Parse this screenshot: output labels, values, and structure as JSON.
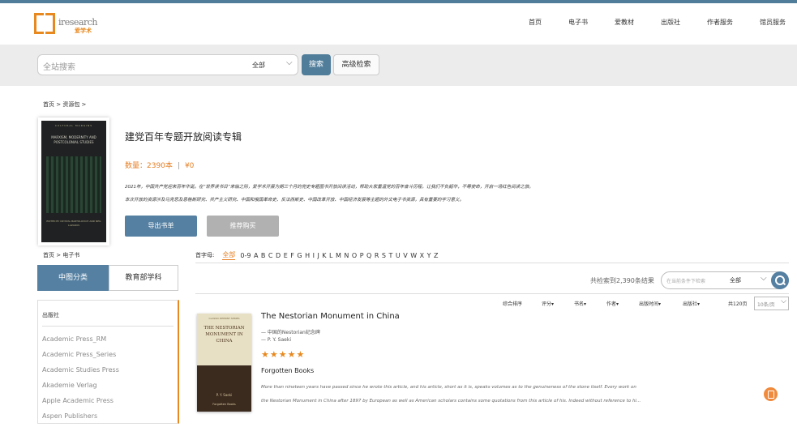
{
  "header": {
    "logo_text": "iresearch",
    "logo_sub": "爱学术",
    "nav": [
      "首页",
      "电子书",
      "爱教材",
      "出版社",
      "作者服务",
      "馆员服务"
    ]
  },
  "search": {
    "placeholder": "全站搜索",
    "scope": "全部",
    "search_button": "搜索",
    "advanced_button": "高级检索"
  },
  "breadcrumb_top": "首页 > 资源包 >",
  "collection": {
    "title": "建党百年专题开放阅读专辑",
    "count": "数量：2390本",
    "price": "¥0",
    "desc_line1": "2021年，中国共产党迎来百年华诞。在“世界读书日”来临之际，爱学术开展为期三个月的党史专题图书开放阅读活动，帮助大家重温党的百年奋斗历程，让我们不负韶华，不辱使命，开启一场红色阅读之旅。",
    "desc_line2": "本次开放的资源涉及马克思及恩格斯研究、共产主义研究、中国和俄国革命史、反法西斯史、中国改革开放、中国经济发展等主题的外文电子书资源，具有重要的学习意义。",
    "export_button": "导出书单",
    "recommend_button": "推荐购买",
    "cover": {
      "series": "CULTURAL MARGINS",
      "title": "MARXISM, MODERNITY AND POSTCOLONIAL STUDIES",
      "editors": "EDITED BY CRYSTAL BARTOLOVICH AND NEIL LAZARUS"
    }
  },
  "breadcrumb_left": "首页 > 电子书",
  "sidebar": {
    "tab_cn": "中图分类",
    "tab_edu": "教育部学科",
    "publisher_heading": "出版社",
    "publishers": [
      "Academic Press_RM",
      "Academic Press_Series",
      "Academic Studies Press",
      "Akademie Verlag",
      "Apple Academic Press",
      "Aspen Publishers"
    ]
  },
  "alphabet": {
    "label": "首字母:",
    "all": "全部",
    "letters": [
      "0-9",
      "A",
      "B",
      "C",
      "D",
      "E",
      "F",
      "G",
      "H",
      "I",
      "J",
      "K",
      "L",
      "M",
      "N",
      "O",
      "P",
      "Q",
      "R",
      "S",
      "T",
      "U",
      "V",
      "W",
      "X",
      "Y",
      "Z"
    ]
  },
  "results": {
    "count_text": "共检索到2,390条结果",
    "filter_placeholder": "在当前条件下检索",
    "filter_scope": "全部",
    "sort": [
      "综合排序",
      "评分",
      "书名",
      "作者",
      "出版时间",
      "出版社"
    ],
    "pages_text": "共120页",
    "per_page": "10条/页"
  },
  "book": {
    "title": "The Nestorian Monument in China",
    "subtitle": "— 中国的Nestorian纪念碑",
    "author": "— P. Y. Saeki",
    "stars": "★★★★★",
    "publisher": "Forgotten Books",
    "desc1": "More than nineteen years have passed since he wrote this article, and his article, short as it is, speaks volumes as to the genuineness of the stone itself. Every work on",
    "desc2": "the Nestorian Monument in China after 1897 by European as well as American scholars contains some quotations from this article of his. Indeed without reference to hi...",
    "cover_series": "CLASSIC REPRINT SERIES",
    "cover_title": "THE NESTORIAN MONUMENT IN CHINA",
    "cover_author": "P. Y. Saeki",
    "cover_pub": "Forgotten Books"
  },
  "colors": {
    "primary": "#5580a2",
    "accent": "#e8891f",
    "topline": "#4f7d9a"
  }
}
